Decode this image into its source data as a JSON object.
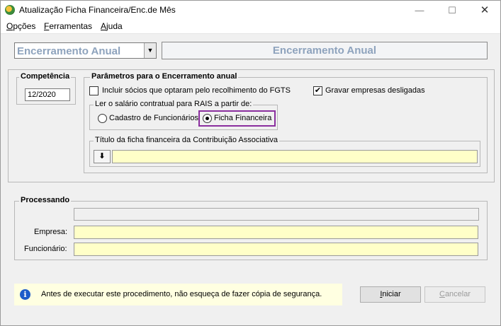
{
  "window": {
    "title": "Atualização Ficha Financeira/Enc.de Mês",
    "min_glyph": "—",
    "max_glyph": "☐",
    "close_glyph": "✕"
  },
  "menu": {
    "items": [
      {
        "label": "Opções",
        "accel": "O",
        "rest": "pções"
      },
      {
        "label": "Ferramentas",
        "accel": "F",
        "rest": "erramentas"
      },
      {
        "label": "Ajuda",
        "accel": "A",
        "rest": "juda"
      }
    ]
  },
  "header": {
    "combo_value": "Encerramento Anual",
    "combo_arrow": "▼",
    "panel_title": "Encerramento Anual"
  },
  "competencia": {
    "label": "Competência",
    "value": "12/2020"
  },
  "parametros": {
    "label": "Parâmetros para o Encerramento anual",
    "incluir_socios": {
      "label": "Incluir sócios que optaram pelo recolhimento do FGTS",
      "checked": false
    },
    "gravar_desligadas": {
      "label": "Gravar empresas desligadas",
      "checked": true,
      "check_glyph": "✔"
    },
    "rais": {
      "label": "Ler o salário contratual para RAIS a partir de:",
      "options": [
        {
          "label": "Cadastro de Funcionários",
          "selected": false
        },
        {
          "label": "Ficha Financeira",
          "selected": true
        }
      ]
    },
    "titulo_ficha": {
      "label": "Título da ficha financeira da Contribuição Associativa",
      "button_glyph": "⬇",
      "value": ""
    }
  },
  "processando": {
    "label": "Processando",
    "progress": 0,
    "empresa_label": "Empresa:",
    "empresa_value": "",
    "funcionario_label": "Funcionário:",
    "funcionario_value": ""
  },
  "footer": {
    "info_icon": "i",
    "info_text": "Antes de executar este procedimento, não esqueça de fazer cópia de segurança.",
    "iniciar": {
      "accel": "I",
      "rest": "niciar"
    },
    "cancelar": {
      "accel": "C",
      "rest": "ancelar"
    }
  },
  "colors": {
    "accent_header_text": "#8ea3bd",
    "highlight_border": "#8a2e9e",
    "input_yellow": "#ffffc8",
    "info_background": "#ffffe1"
  }
}
